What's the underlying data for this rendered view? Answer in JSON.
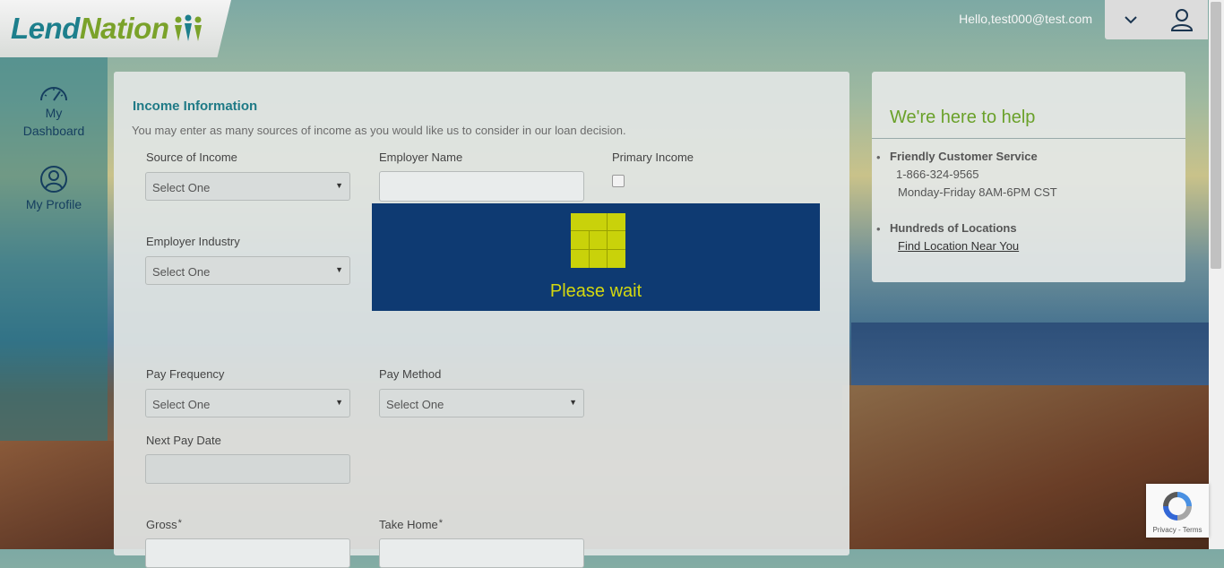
{
  "header": {
    "logo_lend": "Lend",
    "logo_nation": "Nation",
    "greeting": "Hello,test000@test.com"
  },
  "sidebar": {
    "items": [
      {
        "label_line1": "My",
        "label_line2": "Dashboard",
        "icon": "dashboard-gauge-icon"
      },
      {
        "label_line1": "My Profile",
        "label_line2": "",
        "icon": "user-circle-icon"
      }
    ]
  },
  "form": {
    "title": "Income Information",
    "subtitle": "You may enter as many sources of income as you would like us to consider in our loan decision.",
    "source_of_income_label": "Source of Income",
    "source_of_income_value": "Select One",
    "employer_name_label": "Employer Name",
    "employer_name_value": "",
    "primary_income_label": "Primary Income",
    "employer_industry_label": "Employer Industry",
    "employer_industry_value": "Select One",
    "pay_frequency_label": "Pay Frequency",
    "pay_frequency_value": "Select One",
    "pay_method_label": "Pay Method",
    "pay_method_value": "Select One",
    "next_pay_date_label": "Next Pay Date",
    "gross_label": "Gross",
    "take_home_label": "Take Home",
    "required_mark": "*"
  },
  "loading": {
    "text": "Please wait"
  },
  "help": {
    "title": "We're here to help",
    "items": [
      {
        "heading": "Friendly Customer Service",
        "phone": "1-866-324-9565",
        "hours": "Monday-Friday 8AM-6PM CST"
      },
      {
        "heading": "Hundreds of Locations",
        "link": "Find Location Near You"
      }
    ]
  },
  "recaptcha": {
    "text": "Privacy - Terms"
  },
  "colors": {
    "brand_teal": "#1d7f8c",
    "brand_green": "#7aa22a",
    "loading_bg": "#0e3a72",
    "loading_accent": "#c9d20a"
  }
}
